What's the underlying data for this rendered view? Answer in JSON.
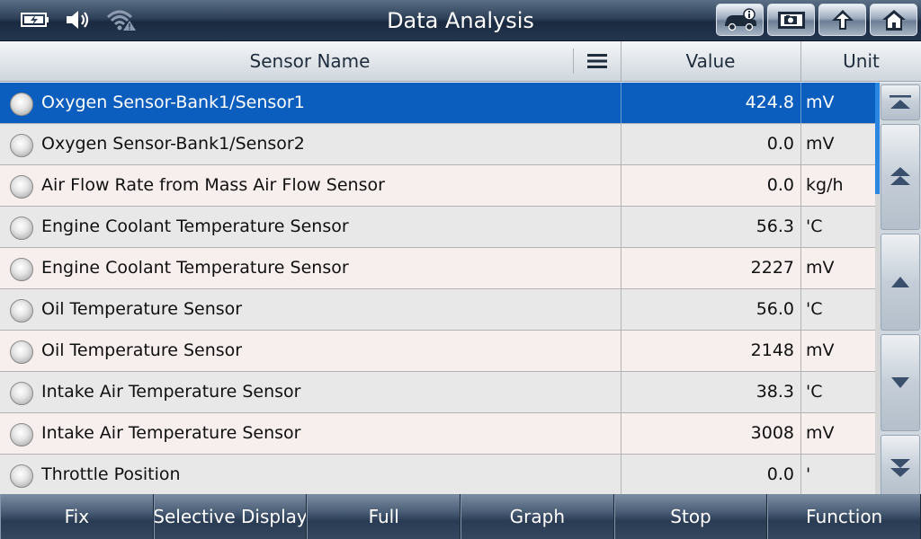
{
  "header": {
    "title": "Data Analysis",
    "status_icons": [
      "battery-charging-icon",
      "speaker-icon",
      "wifi-warning-icon"
    ],
    "buttons": [
      "vehicle-info-icon",
      "screenshot-icon",
      "back-icon",
      "home-icon"
    ]
  },
  "table": {
    "columns": {
      "name": "Sensor Name",
      "value": "Value",
      "unit": "Unit"
    },
    "rows": [
      {
        "name": "Oxygen Sensor-Bank1/Sensor1",
        "value": "424.8",
        "unit": "mV",
        "selected": true
      },
      {
        "name": "Oxygen Sensor-Bank1/Sensor2",
        "value": "0.0",
        "unit": "mV"
      },
      {
        "name": "Air Flow Rate from Mass Air Flow Sensor",
        "value": "0.0",
        "unit": "kg/h"
      },
      {
        "name": "Engine Coolant Temperature Sensor",
        "value": "56.3",
        "unit": "'C"
      },
      {
        "name": "Engine Coolant Temperature Sensor",
        "value": "2227",
        "unit": "mV"
      },
      {
        "name": "Oil Temperature Sensor",
        "value": "56.0",
        "unit": "'C"
      },
      {
        "name": "Oil Temperature Sensor",
        "value": "2148",
        "unit": "mV"
      },
      {
        "name": "Intake Air Temperature Sensor",
        "value": "38.3",
        "unit": "'C"
      },
      {
        "name": "Intake Air Temperature Sensor",
        "value": "3008",
        "unit": "mV"
      },
      {
        "name": "Throttle Position",
        "value": "0.0",
        "unit": "'"
      }
    ]
  },
  "scroll_buttons": [
    "scroll-top-icon",
    "page-up-icon",
    "scroll-up-icon",
    "scroll-down-icon",
    "page-down-icon",
    "scroll-bottom-icon"
  ],
  "bottom_bar": {
    "buttons": [
      "Fix",
      "Selective Display",
      "Full",
      "Graph",
      "Stop",
      "Function"
    ]
  },
  "colors": {
    "selected_row": "#0c5ebe",
    "scroll_thumb": "#2a86e0"
  }
}
